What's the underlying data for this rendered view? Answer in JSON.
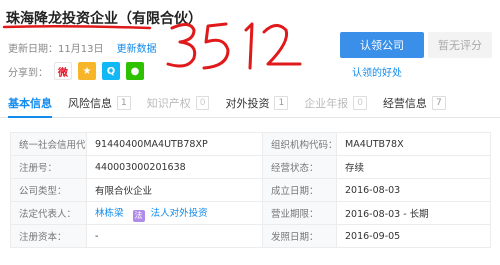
{
  "company": {
    "name": "珠海降龙投资企业（有限合伙）",
    "handwritten_note": "3512"
  },
  "meta": {
    "updated_label": "更新日期：",
    "updated_date": "11月13日",
    "update_link": "更新数据"
  },
  "share": {
    "label": "分享到：",
    "buttons": [
      {
        "name": "weibo-icon",
        "glyph": "微"
      },
      {
        "name": "favorite-icon",
        "glyph": "★"
      },
      {
        "name": "qq-icon",
        "glyph": "Q"
      },
      {
        "name": "wechat-icon",
        "glyph": "●"
      }
    ]
  },
  "actions": {
    "claim_label": "认领公司",
    "rating_label": "暂无评分",
    "benefit_link": "认领的好处"
  },
  "colors": {
    "accent": "#128bed",
    "claim_button": "#3a8fe8",
    "annotation_red": "#e0191b"
  },
  "tabs": [
    {
      "label": "基本信息",
      "count": "",
      "state": "active"
    },
    {
      "label": "风险信息",
      "count": "1",
      "state": "normal"
    },
    {
      "label": "知识产权",
      "count": "0",
      "state": "disabled"
    },
    {
      "label": "对外投资",
      "count": "1",
      "state": "normal"
    },
    {
      "label": "企业年报",
      "count": "0",
      "state": "disabled"
    },
    {
      "label": "经营信息",
      "count": "7",
      "state": "normal"
    }
  ],
  "info": {
    "rows": [
      {
        "l1": "统一社会信用代码：",
        "v1": "91440400MA4UTB78XP",
        "l2": "组织机构代码：",
        "v2": "MA4UTB78X"
      },
      {
        "l1": "注册号：",
        "v1": "440003000201638",
        "l2": "经营状态：",
        "v2": "存续"
      },
      {
        "l1": "公司类型：",
        "v1": "有限合伙企业",
        "l2": "成立日期：",
        "v2": "2016-08-03"
      },
      {
        "l1": "法定代表人：",
        "v1": "林栋梁",
        "l2": "营业期限：",
        "v2": "2016-08-03 - 长期"
      },
      {
        "l1": "注册资本：",
        "v1": "-",
        "l2": "发照日期：",
        "v2": "2016-09-05"
      }
    ],
    "rep_badge": "法",
    "rep_link": "法人对外投资"
  }
}
